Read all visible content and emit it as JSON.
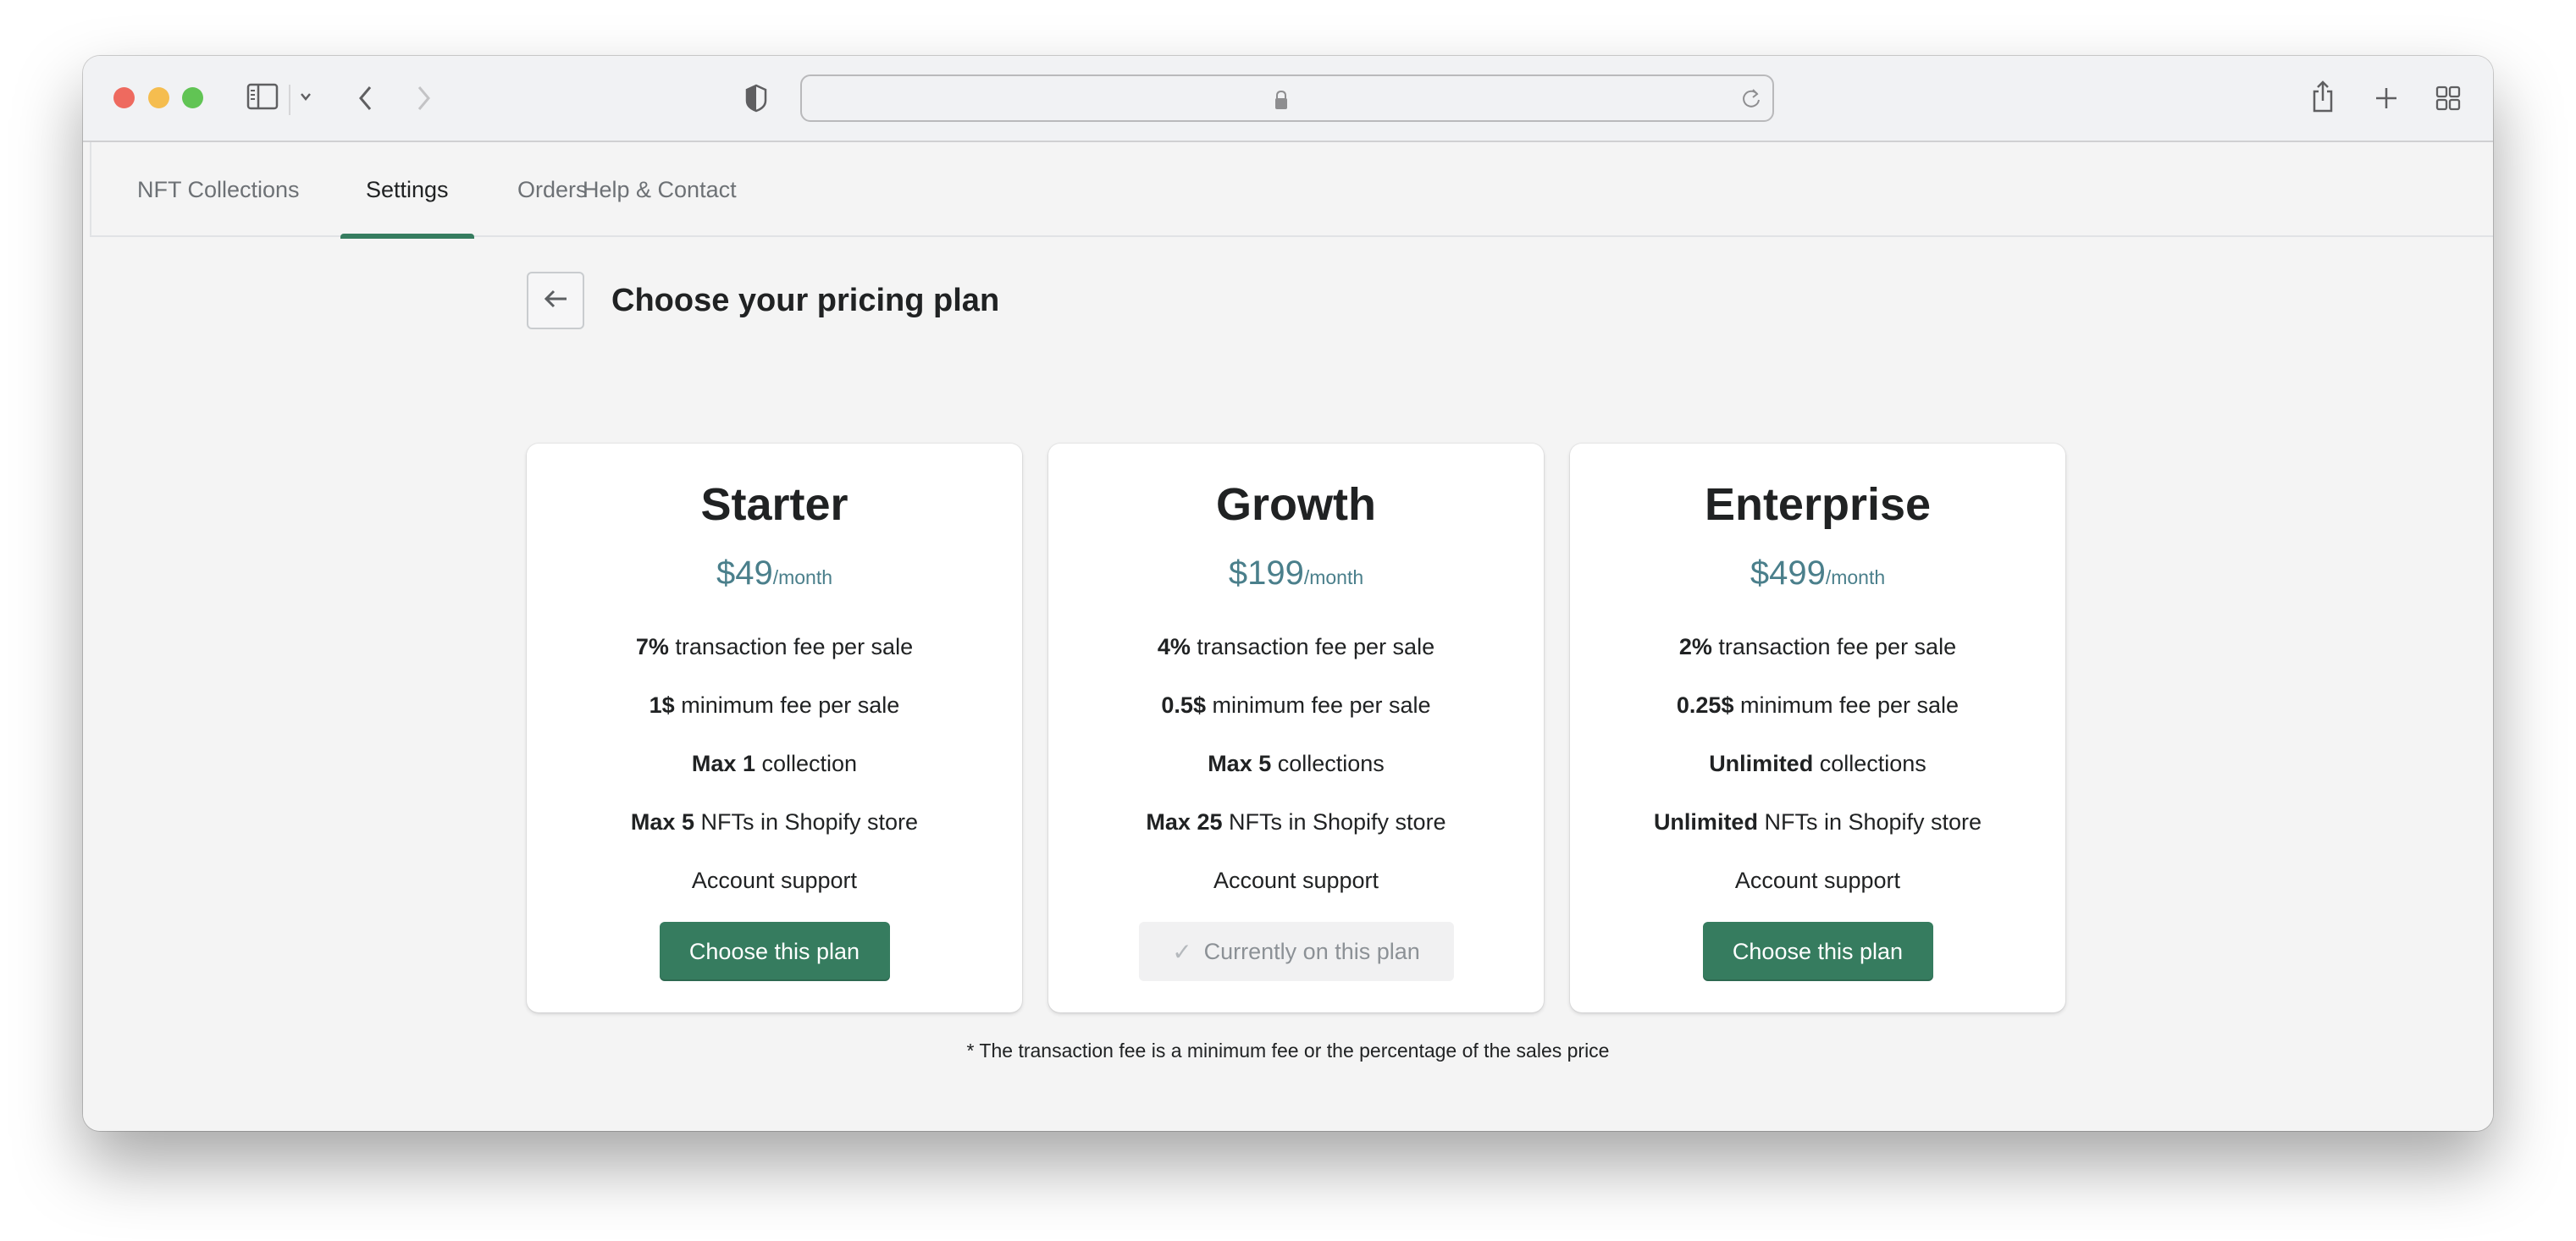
{
  "browser": {
    "url": "",
    "icons": {
      "sidebar": "sidebar-icon",
      "back": "chevron-left-icon",
      "forward": "chevron-right-icon",
      "privacy": "shield-icon",
      "lock": "lock-icon",
      "reload": "reload-icon",
      "share": "share-icon",
      "new_tab": "plus-icon",
      "tab_overview": "grid-icon"
    }
  },
  "nav": {
    "tabs": [
      {
        "label": "NFT Collections",
        "active": false
      },
      {
        "label": "Settings",
        "active": true
      },
      {
        "label": "Orders",
        "active": false
      },
      {
        "label": "Help & Contact",
        "active": false
      }
    ],
    "accent_color": "#367c5f"
  },
  "page": {
    "title": "Choose your pricing plan",
    "back_icon": "arrow-left-icon"
  },
  "plans": [
    {
      "name": "Starter",
      "price": "$49",
      "period": "/month",
      "features": [
        {
          "bold": "7%",
          "text": " transaction fee per sale"
        },
        {
          "bold": "1$",
          "text": " minimum fee per sale"
        },
        {
          "bold": "Max 1",
          "text": " collection"
        },
        {
          "bold": "Max 5",
          "text": " NFTs in Shopify store"
        },
        {
          "bold": "",
          "text": "Account support"
        }
      ],
      "button": {
        "label": "Choose this plan",
        "current": false
      }
    },
    {
      "name": "Growth",
      "price": "$199",
      "period": "/month",
      "features": [
        {
          "bold": "4%",
          "text": " transaction fee per sale"
        },
        {
          "bold": "0.5$",
          "text": " minimum fee per sale"
        },
        {
          "bold": "Max 5",
          "text": " collections"
        },
        {
          "bold": "Max 25",
          "text": " NFTs in Shopify store"
        },
        {
          "bold": "",
          "text": "Account support"
        }
      ],
      "button": {
        "label": "Currently on this plan",
        "current": true,
        "icon": "checkmark-icon"
      }
    },
    {
      "name": "Enterprise",
      "price": "$499",
      "period": "/month",
      "features": [
        {
          "bold": "2%",
          "text": " transaction fee per sale"
        },
        {
          "bold": "0.25$",
          "text": " minimum fee per sale"
        },
        {
          "bold": "Unlimited",
          "text": " collections"
        },
        {
          "bold": "Unlimited",
          "text": " NFTs in Shopify store"
        },
        {
          "bold": "",
          "text": "Account support"
        }
      ],
      "button": {
        "label": "Choose this plan",
        "current": false
      }
    }
  ],
  "footnote": "* The transaction fee is a minimum fee or the percentage of the sales price",
  "colors": {
    "primary_button": "#367c5f",
    "price_text": "#4a7f8b",
    "current_button_bg": "#f1f1f2"
  }
}
